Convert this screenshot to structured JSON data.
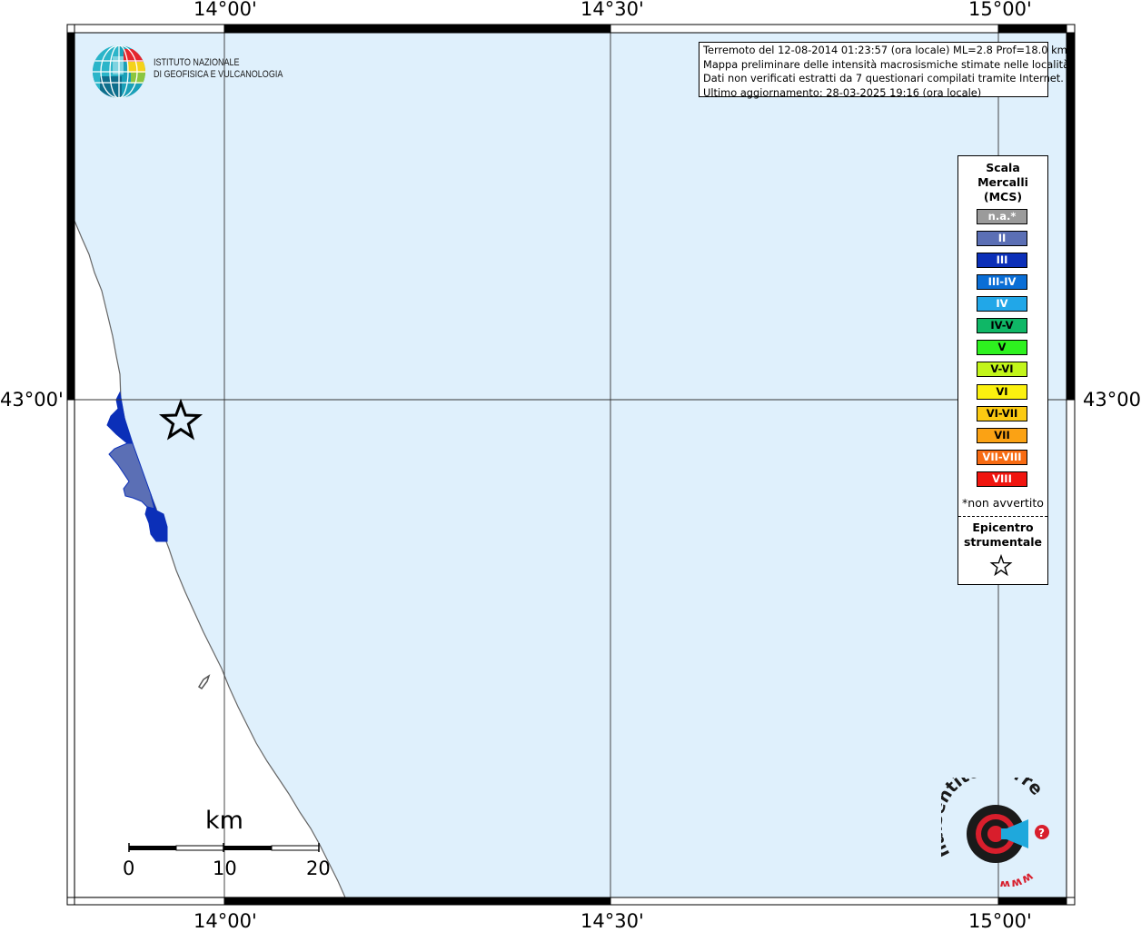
{
  "coordinates": {
    "top": [
      "14°00'",
      "14°30'",
      "15°00'"
    ],
    "bottom": [
      "14°00'",
      "14°30'",
      "15°00'"
    ],
    "left": "43°00'",
    "right": "43°00'"
  },
  "info": {
    "lines": [
      "Terremoto del 12-08-2014 01:23:57 (ora locale) ML=2.8 Prof=18.0 km",
      "Mappa preliminare delle intensità macrosismiche stimate nelle località",
      "Dati non verificati estratti da 7 questionari compilati tramite Internet.",
      "Ultimo aggiornamento: 28-03-2025 19:16 (ora locale)"
    ]
  },
  "logo": {
    "line1": "ISTITUTO NAZIONALE",
    "line2": "DI GEOFISICA E VULCANOLOGIA"
  },
  "legend": {
    "title": [
      "Scala",
      "Mercalli",
      "(MCS)"
    ],
    "classes": [
      {
        "label": "n.a.*",
        "color": "#9b9b9b"
      },
      {
        "label": "II",
        "color": "#5b6fb5"
      },
      {
        "label": "III",
        "color": "#0b2fb8"
      },
      {
        "label": "III-IV",
        "color": "#0a6ed6"
      },
      {
        "label": "IV",
        "color": "#21a7e8"
      },
      {
        "label": "IV-V",
        "color": "#0fb766"
      },
      {
        "label": "V",
        "color": "#2ef21f"
      },
      {
        "label": "V-VI",
        "color": "#c2f51a"
      },
      {
        "label": "VI",
        "color": "#fbf10f"
      },
      {
        "label": "VI-VII",
        "color": "#fbca12"
      },
      {
        "label": "VII",
        "color": "#fba214"
      },
      {
        "label": "VII-VIII",
        "color": "#f86b12"
      },
      {
        "label": "VIII",
        "color": "#f0150f"
      }
    ],
    "note": "*non avvertito",
    "epicenter": [
      "Epicentro",
      "strumentale"
    ]
  },
  "scalebar": {
    "unit": "km",
    "ticks": [
      "0",
      "10",
      "20"
    ]
  },
  "footer_logo": {
    "text": "haisentitoilterremoto.it",
    "url_text": "www."
  },
  "colors": {
    "sea": "#dff0fc",
    "land": "#ffffff",
    "coast": "#666666",
    "intensity_II": "#5b6fb5",
    "intensity_III": "#0b2fb8"
  }
}
